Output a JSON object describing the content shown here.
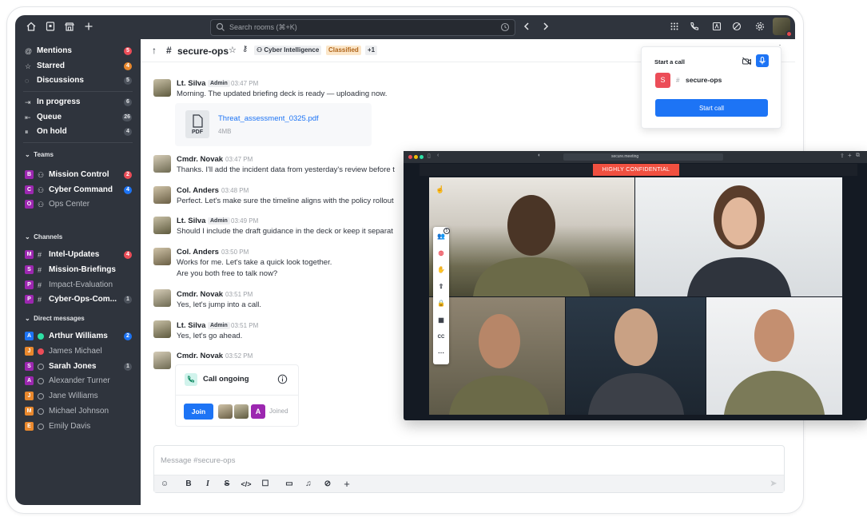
{
  "topbar": {
    "search_placeholder": "Search rooms (⌘+K)"
  },
  "sidebar": {
    "top_items": [
      {
        "label": "Mentions",
        "badge": "5"
      },
      {
        "label": "Starred",
        "badge": "4"
      },
      {
        "label": "Discussions",
        "badge": "5"
      }
    ],
    "status_items": [
      {
        "label": "In progress",
        "badge": "6"
      },
      {
        "label": "Queue",
        "badge": "26"
      },
      {
        "label": "On hold",
        "badge": "4"
      }
    ],
    "teams_heading": "Teams",
    "teams": [
      {
        "letter": "B",
        "label": "Mission Control",
        "badge": "2",
        "color": "#9c27b0"
      },
      {
        "letter": "C",
        "label": "Cyber Command",
        "badge": "4",
        "color": "#9c27b0"
      },
      {
        "letter": "O",
        "label": "Ops Center",
        "badge": "",
        "color": "#9c27b0"
      }
    ],
    "channels_heading": "Channels",
    "channels": [
      {
        "letter": "M",
        "label": "Intel-Updates",
        "badge": "4",
        "color": "#9c27b0"
      },
      {
        "letter": "S",
        "label": "Mission-Briefings",
        "badge": "",
        "color": "#9c27b0"
      },
      {
        "letter": "P",
        "label": "Impact-Evaluation",
        "badge": "",
        "color": "#9c27b0"
      },
      {
        "letter": "P",
        "label": "Cyber-Ops-Com...",
        "badge": "1",
        "color": "#9c27b0"
      }
    ],
    "dm_heading": "Direct messages",
    "dms": [
      {
        "letter": "A",
        "label": "Arthur Williams",
        "badge": "2",
        "color": "#1d74f5",
        "status": "#2de0a5"
      },
      {
        "letter": "J",
        "label": "James Michael",
        "badge": "",
        "color": "#e9882d",
        "status": "#ec4d58"
      },
      {
        "letter": "S",
        "label": "Sarah Jones",
        "badge": "1",
        "color": "#9c27b0",
        "status": ""
      },
      {
        "letter": "A",
        "label": "Alexander Turner",
        "badge": "",
        "color": "#9c27b0",
        "status": ""
      },
      {
        "letter": "J",
        "label": "Jane Williams",
        "badge": "",
        "color": "#e9882d",
        "status": ""
      },
      {
        "letter": "M",
        "label": "Michael Johnson",
        "badge": "",
        "color": "#e9882d",
        "status": ""
      },
      {
        "letter": "E",
        "label": "Emily Davis",
        "badge": "",
        "color": "#e9882d",
        "status": ""
      }
    ]
  },
  "header": {
    "room": "secure-ops",
    "team_chip": "Cyber Intelligence",
    "classified_chip": "Classified",
    "plus_chip": "+1"
  },
  "messages": [
    {
      "name": "Lt. Silva",
      "role": "Admin",
      "time": "03:47 PM",
      "text": "Morning. The updated briefing deck is ready — uploading now."
    },
    {
      "name": "Cmdr. Novak",
      "role": "",
      "time": "03:47 PM",
      "text": "Thanks. I'll add the incident data from yesterday's review before t"
    },
    {
      "name": "Col. Anders",
      "role": "",
      "time": "03:48 PM",
      "text": "Perfect. Let's make sure the timeline aligns with the policy rollout"
    },
    {
      "name": "Lt. Silva",
      "role": "Admin",
      "time": "03:49 PM",
      "text": "Should I include the draft guidance in the deck or keep it separat"
    },
    {
      "name": "Col. Anders",
      "role": "",
      "time": "03:50 PM",
      "text": "Works for me. Let's take a quick look together.",
      "text2": "Are you both free to talk now?"
    },
    {
      "name": "Cmdr. Novak",
      "role": "",
      "time": "03:51 PM",
      "text": "Yes, let's jump into a call."
    },
    {
      "name": "Lt. Silva",
      "role": "Admin",
      "time": "03:51 PM",
      "text": "Yes, let's go ahead."
    },
    {
      "name": "Cmdr. Novak",
      "role": "",
      "time": "03:52 PM",
      "text": ""
    }
  ],
  "file": {
    "name": "Threat_assessment_0325.pdf",
    "size": "4MB",
    "type": "PDF"
  },
  "call_card": {
    "title": "Call ongoing",
    "join_label": "Join",
    "avatar_letter": "A",
    "joined_label": "Joined"
  },
  "composer": {
    "placeholder": "Message #secure-ops"
  },
  "call_popup": {
    "title": "Start a call",
    "room_letter": "S",
    "room_name": "secure-ops",
    "button": "Start call"
  },
  "video": {
    "banner": "HIGHLY CONFIDENTIAL",
    "url": "secure.meeting",
    "participants_count": "5"
  }
}
